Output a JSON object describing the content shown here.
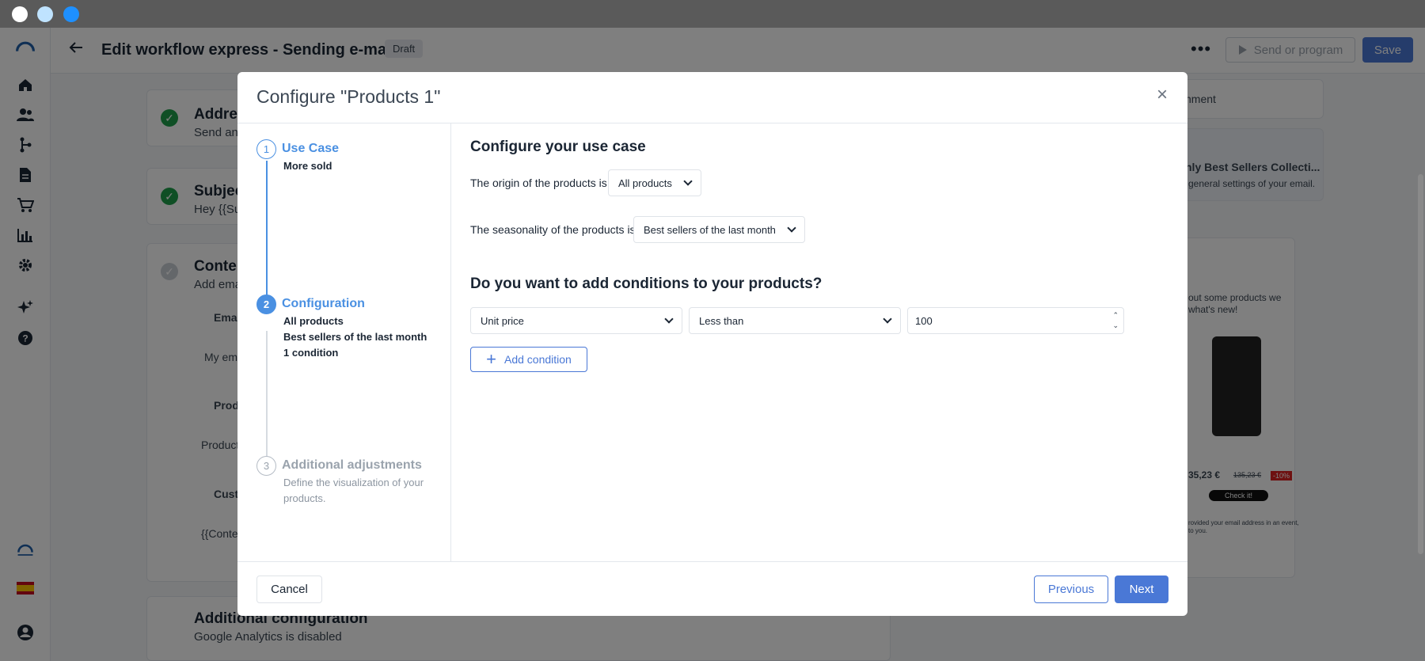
{
  "window": {
    "dot_colors": [
      "#ffffff",
      "#bfe3ff",
      "#1e90ff"
    ]
  },
  "header": {
    "title": "Edit workflow express - Sending e-mails",
    "badge": "Draft",
    "more": "•••",
    "send_label": "Send or program",
    "save_label": "Save"
  },
  "background": {
    "card1_title": "Addres",
    "card1_sub": "Send an",
    "card2_title": "Subjec",
    "card2_sub": "Hey {{Su",
    "card3_title": "Conten",
    "card3_sub": "Add ema",
    "email_label": "Emai",
    "my_email": "My ema",
    "products_label": "Prod",
    "product_value": "Product",
    "custom_label": "Custo",
    "content_tag": "{{Conte",
    "additional_title": "Additional configuration",
    "additional_sub": "Google Analytics is disabled",
    "right_fragment1": "nment",
    "right_fragment2": "hly Best Sellers Collecti...",
    "right_fragment3": "general settings of your email.",
    "preview_text1": "out some products we",
    "preview_text2": "what's new!",
    "preview_price": "35,23 €",
    "preview_old_price": "135,23 €",
    "preview_discount": "-10%",
    "preview_button": "Check it!",
    "preview_footer1": "rovided your email address in an event,",
    "preview_footer2": "to you."
  },
  "modal": {
    "title": "Configure \"Products 1\"",
    "close": "×",
    "steps": [
      {
        "number": "1",
        "title": "Use Case",
        "details": [
          "More sold"
        ]
      },
      {
        "number": "2",
        "title": "Configuration",
        "details": [
          "All products",
          "Best sellers of the last month",
          "1 condition"
        ]
      },
      {
        "number": "3",
        "title": "Additional adjustments",
        "details": [
          "Define the visualization of your products."
        ]
      }
    ],
    "content": {
      "heading": "Configure your use case",
      "origin_label": "The origin of the products is:",
      "origin_value": "All products",
      "seasonality_label": "The seasonality of the products is:",
      "seasonality_value": "Best sellers of the last month",
      "conditions_heading": "Do you want to add conditions to your products?",
      "condition": {
        "field": "Unit price",
        "operator": "Less than",
        "value": "100"
      },
      "add_condition_label": "Add condition"
    },
    "footer": {
      "cancel": "Cancel",
      "previous": "Previous",
      "next": "Next"
    }
  }
}
